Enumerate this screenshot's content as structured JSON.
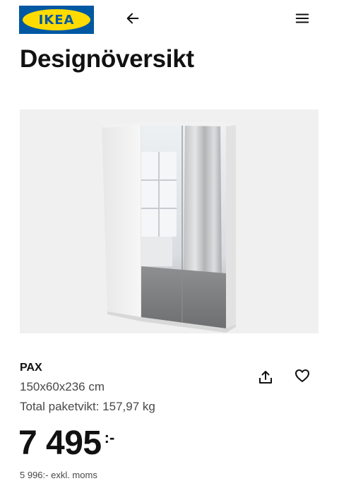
{
  "header": {
    "logo_text": "IKEA",
    "back_icon": "arrow-left-icon",
    "menu_icon": "hamburger-menu-icon"
  },
  "page": {
    "title": "Designöversikt"
  },
  "product": {
    "image_icon": "wardrobe-image",
    "name": "PAX",
    "dimensions": "150x60x236 cm",
    "weight": "Total paketvikt: 157,97 kg",
    "share_icon": "share-icon",
    "favorite_icon": "heart-icon",
    "price_amount": "7 495",
    "price_suffix": ":-",
    "price_ex_vat": "5 996:- exkl. moms"
  },
  "colors": {
    "ikea_blue": "#0058a3",
    "ikea_yellow": "#ffdb00",
    "text_primary": "#111111",
    "text_secondary": "#484848",
    "image_background": "#f0f0f0"
  }
}
